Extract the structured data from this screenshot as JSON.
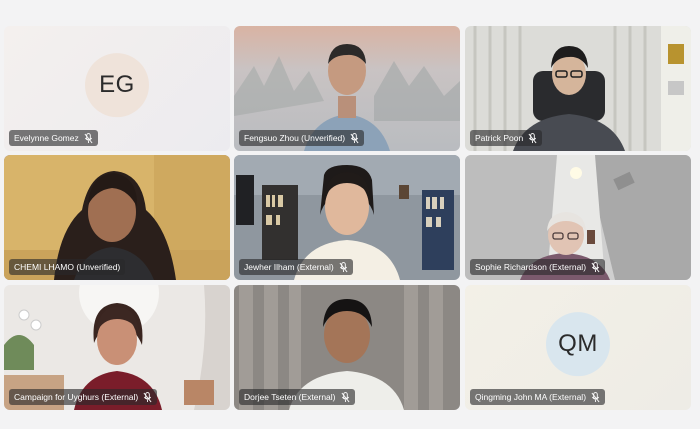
{
  "participants": [
    {
      "name": "Evelynne Gomez",
      "initials": "EG",
      "avatar_color": "#efe3da",
      "tile_bg": "#f1ecea"
    },
    {
      "name": "Fengsuo Zhou (Unverified)"
    },
    {
      "name": "Patrick Poon"
    },
    {
      "name": "CHEMI LHAMO (Unverified)",
      "speaking": true
    },
    {
      "name": "Jewher Ilham (External)"
    },
    {
      "name": "Sophie Richardson (External)"
    },
    {
      "name": "Campaign for Uyghurs (External)"
    },
    {
      "name": "Dorjee Tseten (External)"
    },
    {
      "name": "Qingming John MA (External)",
      "initials": "QM",
      "avatar_color": "#d9e6ee",
      "tile_bg": "#f2efe5"
    }
  ],
  "icons": {
    "mic_state": "mic-off-icon"
  },
  "colors": {
    "speaking_border": "#5b5fc7",
    "label_bg": "#28282a"
  }
}
